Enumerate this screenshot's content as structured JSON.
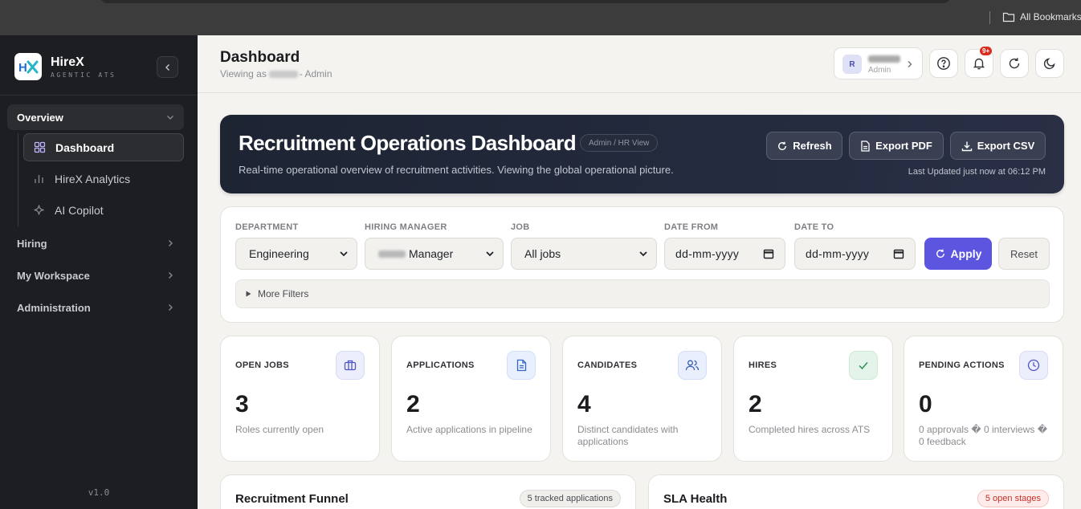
{
  "browser": {
    "bookmarks_label": "All Bookmarks"
  },
  "brand": {
    "name": "HireX",
    "tagline": "AGENTIC ATS"
  },
  "sidebar": {
    "overview": {
      "label": "Overview",
      "items": [
        {
          "label": "Dashboard",
          "icon": "grid-icon",
          "active": true
        },
        {
          "label": "HireX Analytics",
          "icon": "bar-chart-icon"
        },
        {
          "label": "AI Copilot",
          "icon": "sparkle-icon"
        }
      ]
    },
    "groups": [
      {
        "label": "Hiring"
      },
      {
        "label": "My Workspace"
      },
      {
        "label": "Administration"
      }
    ],
    "version": "v1.0"
  },
  "header": {
    "title": "Dashboard",
    "viewing_prefix": "Viewing as",
    "viewing_suffix": "- Admin",
    "user": {
      "initial": "R",
      "role": "Admin"
    },
    "notifications_badge": "9+"
  },
  "hero": {
    "title": "Recruitment Operations Dashboard",
    "tag": "Admin / HR View",
    "description": "Real-time operational overview of recruitment activities. Viewing the global operational picture.",
    "buttons": {
      "refresh": "Refresh",
      "export_pdf": "Export PDF",
      "export_csv": "Export CSV"
    },
    "last_updated": "Last Updated just now at 06:12 PM"
  },
  "filters": {
    "department": {
      "label": "DEPARTMENT",
      "value": "Engineering"
    },
    "hiring_manager": {
      "label": "HIRING MANAGER",
      "value": "Manager"
    },
    "job": {
      "label": "JOB",
      "value": "All jobs"
    },
    "date_from": {
      "label": "DATE FROM",
      "value": "dd-mm-yyyy"
    },
    "date_to": {
      "label": "DATE TO",
      "value": "dd-mm-yyyy"
    },
    "apply_label": "Apply",
    "reset_label": "Reset",
    "more_filters_label": "More Filters"
  },
  "stats": [
    {
      "label": "OPEN JOBS",
      "value": "3",
      "sub": "Roles currently open",
      "icon": "briefcase-icon",
      "icon_bg": "#eceefc",
      "icon_color": "#4f56c9"
    },
    {
      "label": "APPLICATIONS",
      "value": "2",
      "sub": "Active applications in pipeline",
      "icon": "document-icon",
      "icon_bg": "#e8effd",
      "icon_color": "#3566c8"
    },
    {
      "label": "CANDIDATES",
      "value": "4",
      "sub": "Distinct candidates with applications",
      "icon": "users-icon",
      "icon_bg": "#e9effc",
      "icon_color": "#3a5fb8"
    },
    {
      "label": "HIRES",
      "value": "2",
      "sub": "Completed hires across ATS",
      "icon": "check-icon",
      "icon_bg": "#e4f4ea",
      "icon_color": "#2f8f52"
    },
    {
      "label": "PENDING ACTIONS",
      "value": "0",
      "sub": "0 approvals � 0 interviews � 0 feedback",
      "icon": "clock-icon",
      "icon_bg": "#eceefc",
      "icon_color": "#4f56c9"
    }
  ],
  "panels": {
    "funnel": {
      "title": "Recruitment Funnel",
      "badge": "5 tracked applications"
    },
    "sla": {
      "title": "SLA Health",
      "badge": "5 open stages"
    }
  },
  "colors": {
    "accent": "#5b55e0",
    "sidebar_bg": "#1d1e21",
    "hero_bg": "#1d2432",
    "danger": "#d92d20"
  }
}
